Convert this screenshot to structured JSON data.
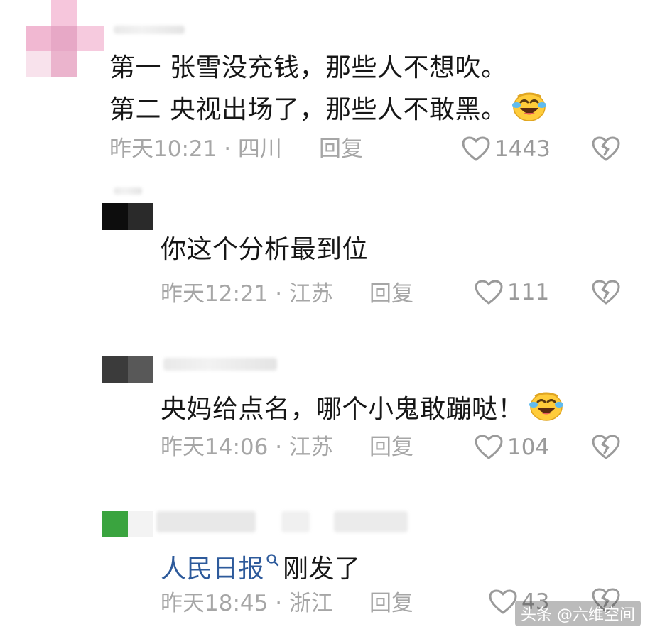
{
  "comments": [
    {
      "lines": [
        "第一 张雪没充钱，那些人不想吹。",
        "第二 央视出场了，那些人不敢黑。"
      ],
      "time": "昨天10:21 · 四川",
      "reply": "回复",
      "likes": "1443",
      "emoji": "laughing-crying-emoji"
    },
    {
      "lines": [
        "你这个分析最到位"
      ],
      "time": "昨天12:21 · 江苏",
      "reply": "回复",
      "likes": "111"
    },
    {
      "lines": [
        "央妈给点名，哪个小鬼敢蹦哒！"
      ],
      "time": "昨天14:06 · 江苏",
      "reply": "回复",
      "likes": "104",
      "emoji": "laughing-crying-emoji"
    },
    {
      "link": "人民日报",
      "rest": "刚发了",
      "time": "昨天18:45 · 浙江",
      "reply": "回复",
      "likes": "43"
    }
  ],
  "watermark": "头条 @六维空间",
  "colors": {
    "link": "#2d5a9b",
    "meta": "#a6a6a6"
  }
}
